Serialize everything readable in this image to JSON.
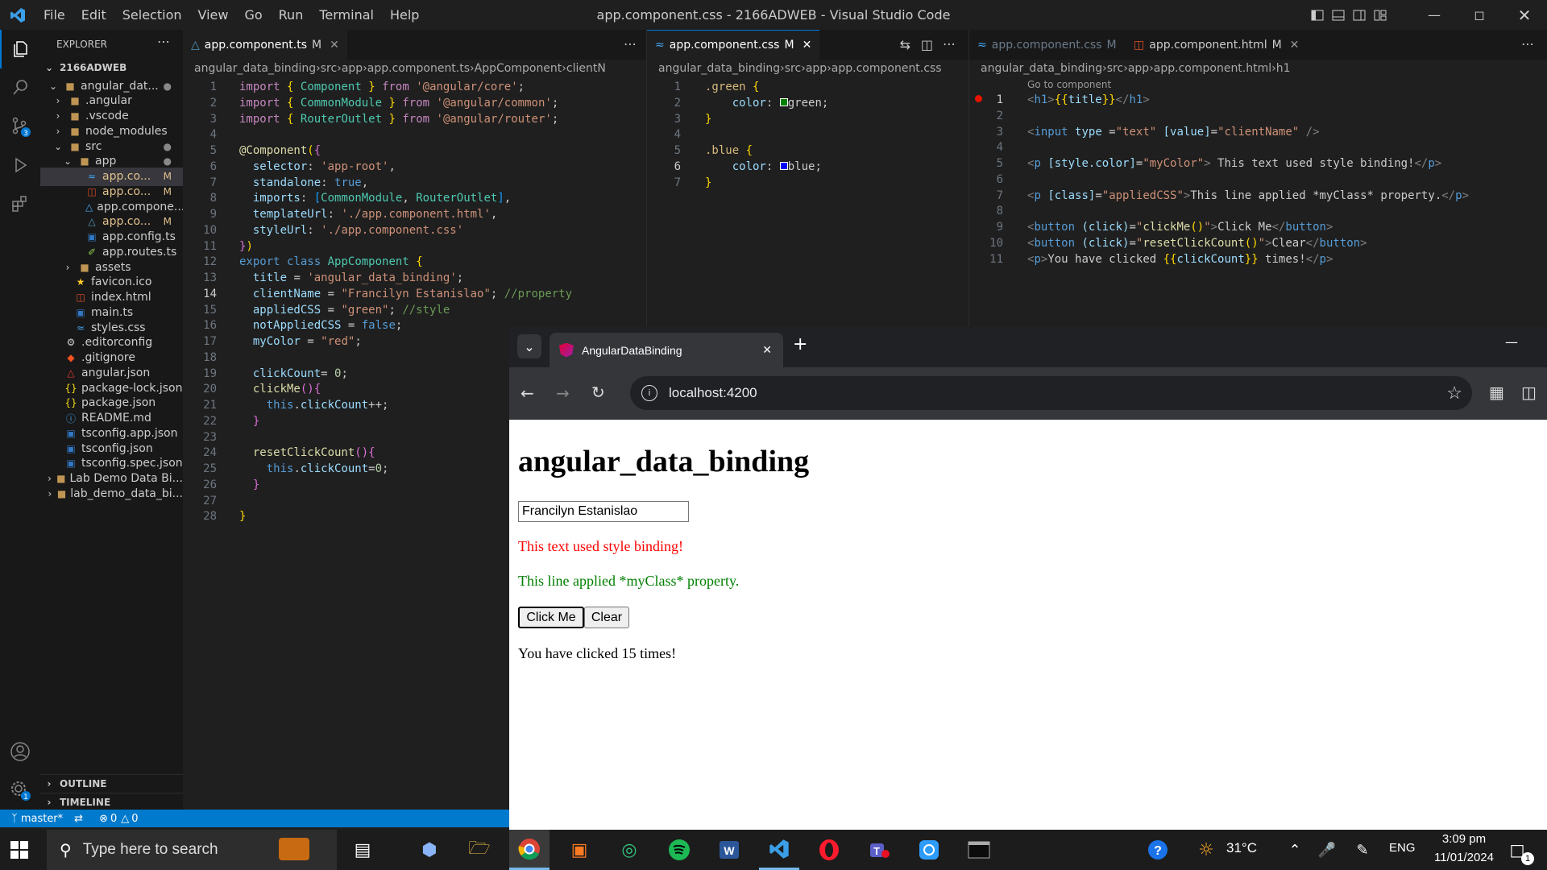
{
  "window": {
    "title": "app.component.css - 2166ADWEB - Visual Studio Code"
  },
  "menu": [
    "File",
    "Edit",
    "Selection",
    "View",
    "Go",
    "Run",
    "Terminal",
    "Help"
  ],
  "explorer": {
    "header": "EXPLORER",
    "root": "2166ADWEB",
    "items": [
      {
        "label": "angular_dat...",
        "icon": "folder-open",
        "depth": 1,
        "status": "dot"
      },
      {
        "label": ".angular",
        "icon": "folder",
        "depth": 2,
        "status": ""
      },
      {
        "label": ".vscode",
        "icon": "folder",
        "depth": 2,
        "status": ""
      },
      {
        "label": "node_modules",
        "icon": "folder",
        "depth": 2,
        "status": ""
      },
      {
        "label": "src",
        "icon": "folder-open",
        "depth": 2,
        "status": "dot"
      },
      {
        "label": "app",
        "icon": "folder-open",
        "depth": 3,
        "status": "dot"
      },
      {
        "label": "app.co...",
        "icon": "css",
        "depth": 4,
        "status": "M"
      },
      {
        "label": "app.co...",
        "icon": "html",
        "depth": 4,
        "status": "M"
      },
      {
        "label": "app.compone...",
        "icon": "spec",
        "depth": 4,
        "status": ""
      },
      {
        "label": "app.co...",
        "icon": "angular-ts",
        "depth": 4,
        "status": "M"
      },
      {
        "label": "app.config.ts",
        "icon": "ts",
        "depth": 4,
        "status": ""
      },
      {
        "label": "app.routes.ts",
        "icon": "routes",
        "depth": 4,
        "status": ""
      },
      {
        "label": "assets",
        "icon": "folder",
        "depth": 3,
        "status": ""
      },
      {
        "label": "favicon.ico",
        "icon": "star",
        "depth": 3,
        "status": ""
      },
      {
        "label": "index.html",
        "icon": "html",
        "depth": 3,
        "status": ""
      },
      {
        "label": "main.ts",
        "icon": "ts",
        "depth": 3,
        "status": ""
      },
      {
        "label": "styles.css",
        "icon": "css",
        "depth": 3,
        "status": ""
      },
      {
        "label": ".editorconfig",
        "icon": "gear",
        "depth": 2,
        "status": ""
      },
      {
        "label": ".gitignore",
        "icon": "git",
        "depth": 2,
        "status": ""
      },
      {
        "label": "angular.json",
        "icon": "angular",
        "depth": 2,
        "status": ""
      },
      {
        "label": "package-lock.json",
        "icon": "json",
        "depth": 2,
        "status": ""
      },
      {
        "label": "package.json",
        "icon": "json",
        "depth": 2,
        "status": ""
      },
      {
        "label": "README.md",
        "icon": "info",
        "depth": 2,
        "status": ""
      },
      {
        "label": "tsconfig.app.json",
        "icon": "tsconfig",
        "depth": 2,
        "status": ""
      },
      {
        "label": "tsconfig.json",
        "icon": "tsconfig",
        "depth": 2,
        "status": ""
      },
      {
        "label": "tsconfig.spec.json",
        "icon": "tsconfig",
        "depth": 2,
        "status": ""
      },
      {
        "label": "Lab Demo Data Bi...",
        "icon": "folder",
        "depth": 1,
        "status": ""
      },
      {
        "label": "lab_demo_data_bi...",
        "icon": "folder",
        "depth": 1,
        "status": ""
      }
    ],
    "outline": "OUTLINE",
    "timeline": "TIMELINE"
  },
  "editor1": {
    "tab": "app.component.ts",
    "tab_status": "M",
    "breadcrumb": [
      "angular_data_binding",
      "src",
      "app",
      "app.component.ts",
      "AppComponent",
      "clientN"
    ],
    "lines": [
      "1",
      "2",
      "3",
      "4",
      "5",
      "6",
      "7",
      "8",
      "9",
      "10",
      "11",
      "12",
      "13",
      "14",
      "15",
      "16",
      "17",
      "18",
      "19",
      "20",
      "21",
      "22",
      "23",
      "24",
      "25",
      "26",
      "27",
      "28"
    ]
  },
  "editor2": {
    "tab": "app.component.css",
    "tab_status": "M",
    "breadcrumb": [
      "angular_data_binding",
      "src",
      "app",
      "app.component.css"
    ],
    "lines": [
      "1",
      "2",
      "3",
      "4",
      "5",
      "6",
      "7"
    ]
  },
  "editor3": {
    "tab_inactive": "app.component.css",
    "tab_inactive_status": "M",
    "tab": "app.component.html",
    "tab_status": "M",
    "breadcrumb": [
      "angular_data_binding",
      "src",
      "app",
      "app.component.html",
      "h1"
    ],
    "hint": "Go to component",
    "lines": [
      "1",
      "2",
      "3",
      "4",
      "5",
      "6",
      "7",
      "8",
      "9",
      "10",
      "11"
    ]
  },
  "statusbar": {
    "branch": "master*",
    "errors": "0",
    "warnings": "0"
  },
  "browser": {
    "tab_title": "AngularDataBinding",
    "url": "localhost:4200",
    "page": {
      "heading": "angular_data_binding",
      "input_value": "Francilyn Estanislao",
      "styled_text": "This text used style binding!",
      "class_text": "This line applied *myClass* property.",
      "click_button": "Click Me",
      "clear_button": "Clear",
      "count_text": "You have clicked 15 times!"
    }
  },
  "taskbar": {
    "search_placeholder": "Type here to search",
    "temperature": "31°C",
    "language": "ENG",
    "time": "3:09 pm",
    "date": "11/01/2024",
    "notifications": "1"
  },
  "colors": {
    "accent": "#0078d4",
    "statusbar": "#007acc",
    "styled_text": "#ff0000",
    "class_text": "#008000"
  }
}
